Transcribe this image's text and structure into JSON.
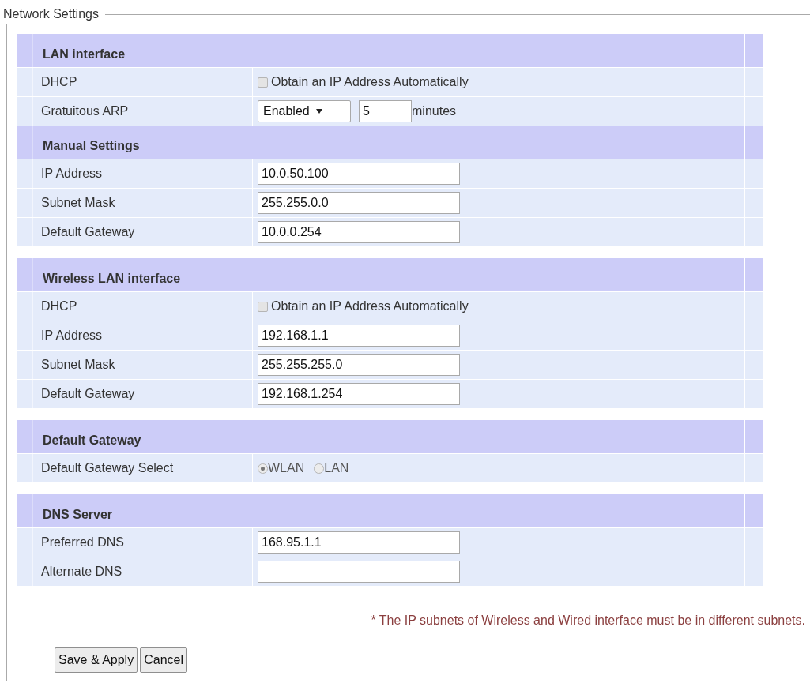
{
  "title": "Network Settings",
  "groups": [
    {
      "sections": [
        {
          "title": "LAN interface",
          "rows": [
            {
              "kind": "checkbox",
              "label": "DHCP",
              "text": "Obtain an IP Address Automatically",
              "checked": false
            },
            {
              "kind": "select_number",
              "label": "Gratuitous ARP",
              "select": "Enabled",
              "number": "5",
              "unit": "minutes"
            }
          ]
        },
        {
          "title": "Manual Settings",
          "rows": [
            {
              "kind": "text",
              "label": "IP Address",
              "value": "10.0.50.100"
            },
            {
              "kind": "text",
              "label": "Subnet Mask",
              "value": "255.255.0.0"
            },
            {
              "kind": "text",
              "label": "Default Gateway",
              "value": "10.0.0.254"
            }
          ]
        }
      ]
    },
    {
      "sections": [
        {
          "title": "Wireless LAN interface",
          "rows": [
            {
              "kind": "checkbox",
              "label": "DHCP",
              "text": "Obtain an IP Address Automatically",
              "checked": false
            },
            {
              "kind": "text",
              "label": "IP Address",
              "value": "192.168.1.1"
            },
            {
              "kind": "text",
              "label": "Subnet Mask",
              "value": "255.255.255.0"
            },
            {
              "kind": "text",
              "label": "Default Gateway",
              "value": "192.168.1.254"
            }
          ]
        }
      ]
    },
    {
      "sections": [
        {
          "title": "Default Gateway",
          "rows": [
            {
              "kind": "radio",
              "label": "Default Gateway Select",
              "options": [
                {
                  "label": "WLAN",
                  "selected": true
                },
                {
                  "label": "LAN",
                  "selected": false
                }
              ]
            }
          ]
        }
      ]
    },
    {
      "sections": [
        {
          "title": "DNS Server",
          "rows": [
            {
              "kind": "text",
              "label": "Preferred DNS",
              "value": "168.95.1.1"
            },
            {
              "kind": "text",
              "label": "Alternate DNS"
            }
          ]
        }
      ]
    }
  ],
  "note": "* The IP subnets of Wireless and Wired interface must be in different subnets.",
  "buttons": [
    "Save & Apply",
    "Cancel"
  ]
}
